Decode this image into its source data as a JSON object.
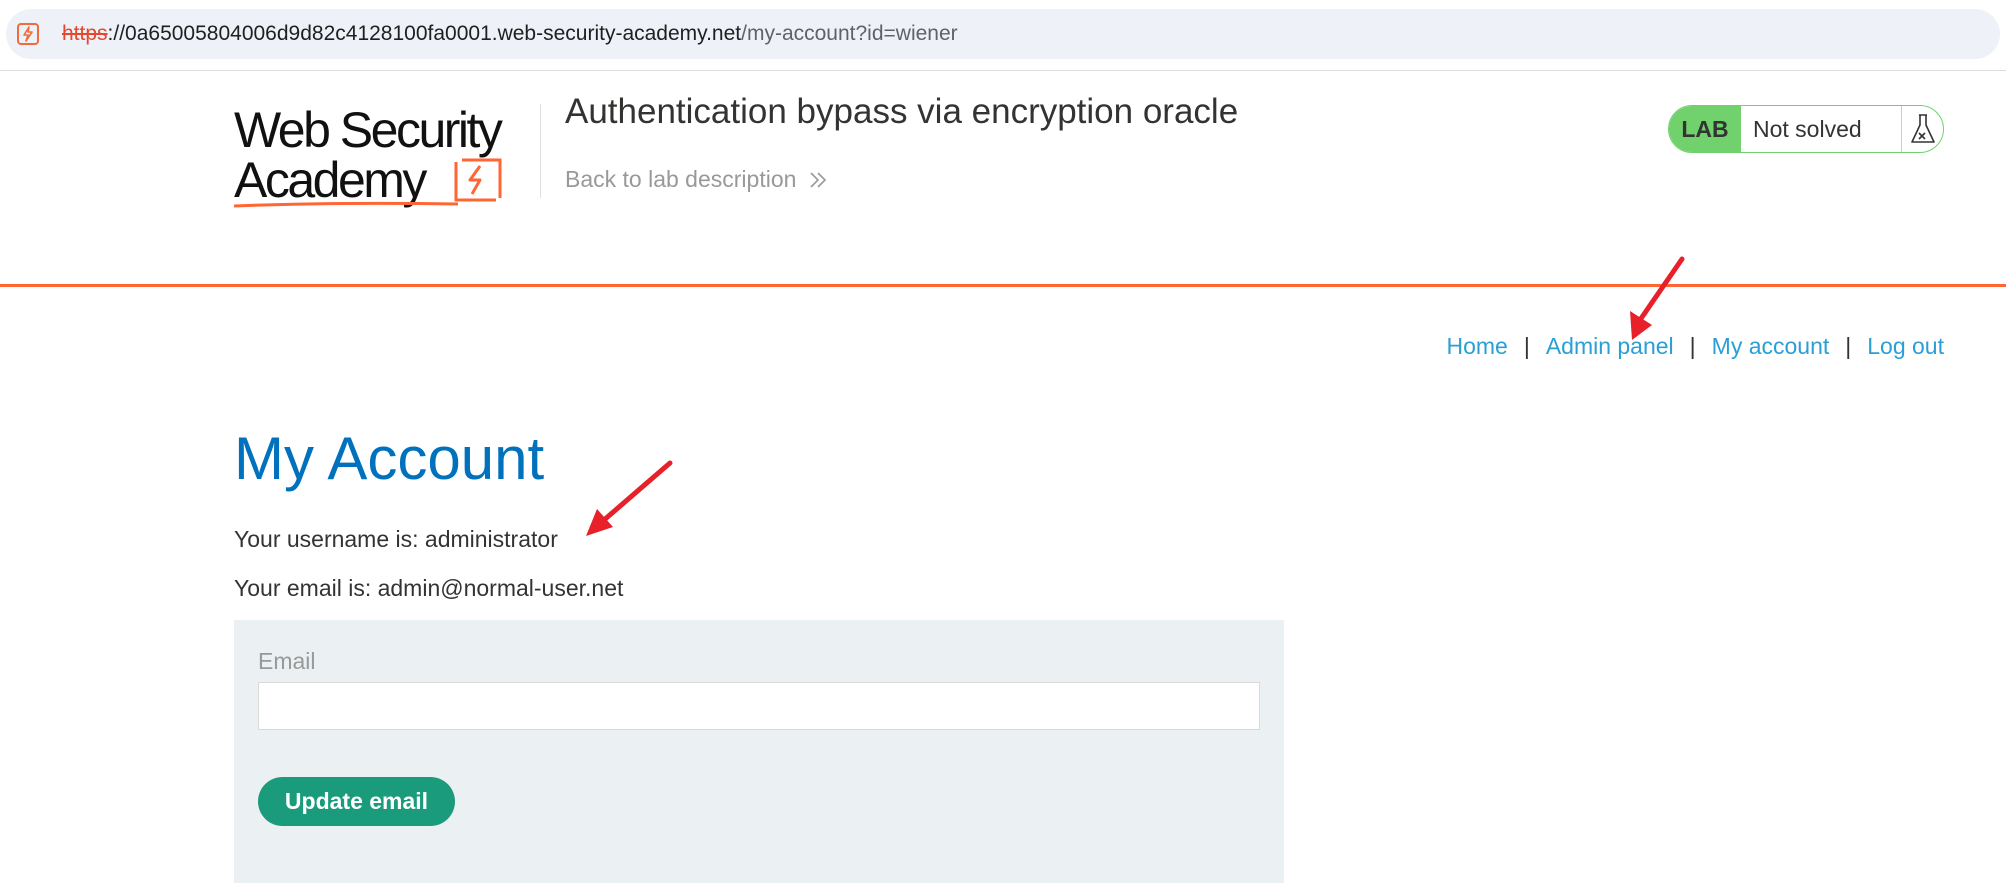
{
  "browser": {
    "url_scheme": "https",
    "url_host": "://0a65005804006d9d82c4128100fa0001.web-security-academy.net",
    "url_path": "/my-account?id=wiener"
  },
  "header": {
    "logo_line1": "Web Security",
    "logo_line2": "Academy",
    "lab_title": "Authentication bypass via encryption oracle",
    "back_link": "Back to lab description",
    "lab_badge": "LAB",
    "lab_status": "Not solved"
  },
  "nav": {
    "items": [
      {
        "label": "Home"
      },
      {
        "label": "Admin panel"
      },
      {
        "label": "My account"
      },
      {
        "label": "Log out"
      }
    ],
    "separator": "|"
  },
  "account": {
    "title": "My Account",
    "username_line": "Your username is: administrator",
    "email_line": "Your email is: admin@normal-user.net",
    "email_label": "Email",
    "email_value": "",
    "update_button": "Update email"
  },
  "colors": {
    "accent_orange": "#ff6633",
    "title_blue": "#0071bc",
    "link_blue": "#2a9fd6",
    "lab_green": "#70d16d",
    "button_teal": "#1a9b7c",
    "annotation_red": "#e8202a"
  },
  "icons": {
    "site": "burp-lightning-icon",
    "back": "double-chevron-right-icon",
    "lab": "flask-icon"
  }
}
